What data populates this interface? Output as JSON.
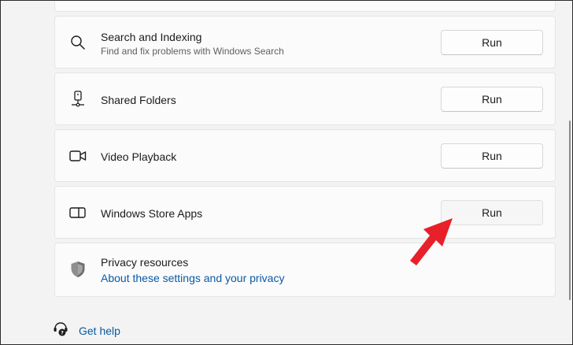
{
  "troubleshooters": [
    {
      "title": "Search and Indexing",
      "subtitle": "Find and fix problems with Windows Search",
      "icon": "search-icon",
      "button": "Run"
    },
    {
      "title": "Shared Folders",
      "icon": "shared-folders-icon",
      "button": "Run"
    },
    {
      "title": "Video Playback",
      "icon": "video-camera-icon",
      "button": "Run"
    },
    {
      "title": "Windows Store Apps",
      "icon": "store-apps-icon",
      "button": "Run"
    }
  ],
  "privacy": {
    "title": "Privacy resources",
    "link": "About these settings and your privacy",
    "icon": "shield-icon"
  },
  "help": {
    "label": "Get help",
    "icon": "help-chat-icon"
  },
  "annotation": {
    "icon": "red-arrow-pointer-icon",
    "color": "#e8202a"
  },
  "colors": {
    "link": "#0a5aa5",
    "card_background": "#fbfbfb",
    "page_background": "#f3f3f3"
  }
}
